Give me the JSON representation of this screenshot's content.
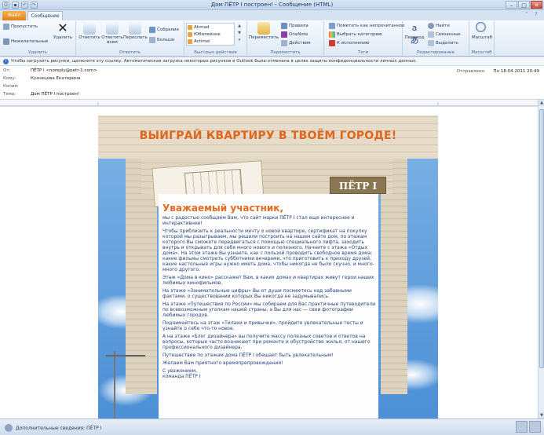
{
  "window": {
    "title": "Дом ПЁТР I построен! - Сообщение (HTML)"
  },
  "tabs": {
    "file": "Файл",
    "message": "Сообщение"
  },
  "ribbon": {
    "delete_group": {
      "ignore": "Пропустить",
      "junk": "Нежелательные",
      "delete": "Удалить",
      "label": "Удалить"
    },
    "respond_group": {
      "reply": "Ответить",
      "reply_all": "Ответить всем",
      "forward": "Переслать",
      "meeting": "Собрание",
      "more": "Больше",
      "label": "Ответить"
    },
    "quicksteps": {
      "items": [
        "Ahmad",
        "Юбилейное",
        "Actimel"
      ],
      "label": "Быстрые действия"
    },
    "move_group": {
      "move": "Переместить",
      "rules": "Правила",
      "onenote": "OneNote",
      "actions": "Действия",
      "label": "Переместить"
    },
    "tags_group": {
      "mark_unread": "Пометить как непрочитанное",
      "categorize": "Выбрать категорию",
      "follow_up": "К исполнению",
      "label": "Теги"
    },
    "editing_group": {
      "translate": "Перевод",
      "find": "Найти",
      "related": "Связанные",
      "select": "Выделить",
      "label": "Редактирование"
    },
    "zoom_group": {
      "zoom": "Масштаб",
      "label": "Масштаб"
    }
  },
  "infobar": {
    "text": "Чтобы загрузить рисунки, щелкните эту ссылку. Автоматическая загрузка некоторых рисунков в Outlook была отменена в целях защиты конфиденциальности личных данных."
  },
  "header": {
    "from_label": "От:",
    "from_value": "ПЁТР I <noreply@petr-1.com>",
    "to_label": "Кому:",
    "to_value": "Кузнецова Екатерина",
    "cc_label": "Копия:",
    "cc_value": "",
    "subject_label": "Тема:",
    "subject_value": "Дом ПЁТР I построен!",
    "sent_label": "Отправлено:",
    "sent_value": "Пн 18.04.2011 20:49"
  },
  "email": {
    "headline": "ВЫИГРАЙ КВАРТИРУ В ТВОЁМ ГОРОДЕ!",
    "logo": "ПЁТР I",
    "greeting": "Уважаемый участник,",
    "paragraphs": [
      "мы с радостью сообщаем Вам, что сайт марки ПЁТР I стал еще интереснее и интерактивнее!",
      "Чтобы приблизить к реальности мечту о новой квартире, сертификат на покупку которой мы разыгрываем, мы решили построить на нашем сайте дом, по этажам которого Вы сможете передвигаться с помощью специального лифта, заходить внутрь и открывать для себя много нового и полезного. Начните с этажа «Отдых дома». На этом этаже Вы узнаете, как с пользой проводить свободное время дома: какие фильмы смотреть субботними вечерами, что приготовить к приходу друзей, какие настольные игры нужно иметь дома, чтобы никогда не было скучно, и много-много другого.",
      "Этаж «Дома в кино» расскажет Вам, в каких домах и квартирах живут герои наших любимых кинофильмов.",
      "На этаже «Занимательные цифры» Вы от души посмеетесь над забавными фактами, о существовании которых Вы никогда не задумывались.",
      "На этаже «Путешествия по России» мы собираем для Вас практичные путеводители по всевозможным уголкам нашей страны, а Вы для нас — свои фотографии любимых городов.",
      "Поднимайтесь на этаж «Тилаки и привычки», пройдите увлекательные тесты и узнайте о себе что-то новое.",
      "А на этаже «Блог дизайнера» вы получите массу полезных советов и ответов на вопросы, которые часто возникают при ремонте и обустройстве жилья, от нашего профессионального дизайнера.",
      "Путешествие по этажам дома ПЁТР I обещает быть увлекательным!",
      "Желаем Вам приятного времяпрепровождения!",
      "С уважением,\nкоманда ПЁТР I"
    ]
  },
  "status": {
    "text": "Дополнительные сведения: ПЁТР I"
  },
  "colors": {
    "accent": "#e0661c",
    "text_blue": "#25427c",
    "file_tab": "#e3801c"
  }
}
